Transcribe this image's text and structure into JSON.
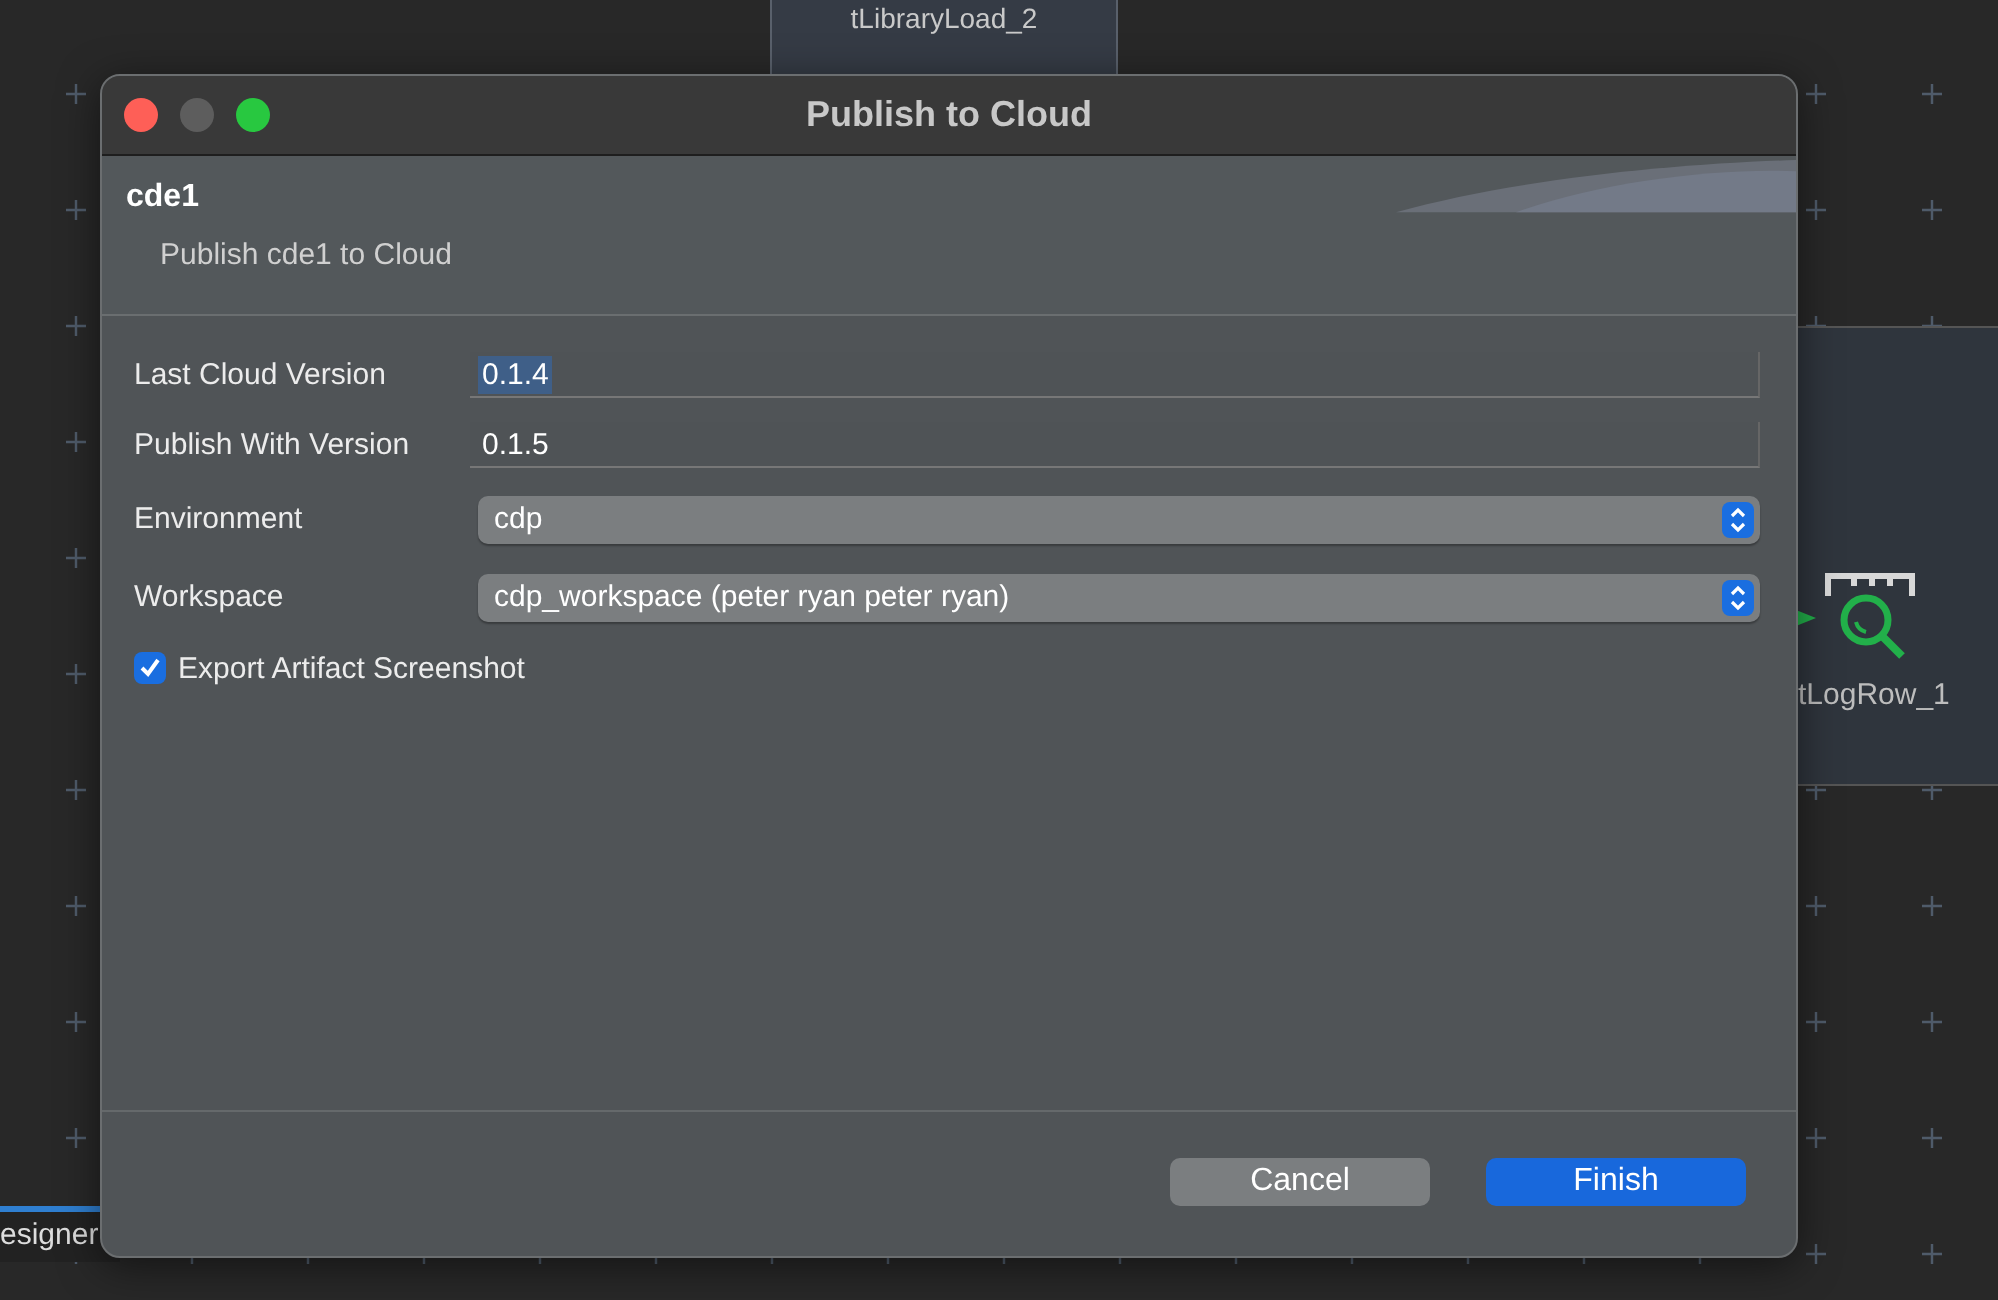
{
  "canvas": {
    "nodes": [
      {
        "kind": "top",
        "label": "tLibraryLoad_2"
      },
      {
        "kind": "log",
        "label": "tLogRow_1"
      }
    ],
    "tab": {
      "label": "esigner",
      "selected": true
    }
  },
  "dialog": {
    "title": "Publish to Cloud",
    "header": {
      "title": "cde1",
      "subtitle": "Publish cde1 to Cloud"
    },
    "fields": [
      {
        "kind": "text",
        "label": "Last Cloud Version",
        "value": "0.1.4",
        "text_selected": true
      },
      {
        "kind": "text",
        "label": "Publish With Version",
        "value": "0.1.5",
        "text_selected": false
      },
      {
        "kind": "select",
        "label": "Environment",
        "value": "cdp"
      },
      {
        "kind": "select",
        "label": "Workspace",
        "value": "cdp_workspace (peter ryan peter ryan)"
      },
      {
        "kind": "checkbox",
        "label": "Export Artifact Screenshot",
        "checked": true
      }
    ],
    "buttons": [
      {
        "label": "Cancel",
        "primary": false
      },
      {
        "label": "Finish",
        "primary": true
      }
    ]
  }
}
